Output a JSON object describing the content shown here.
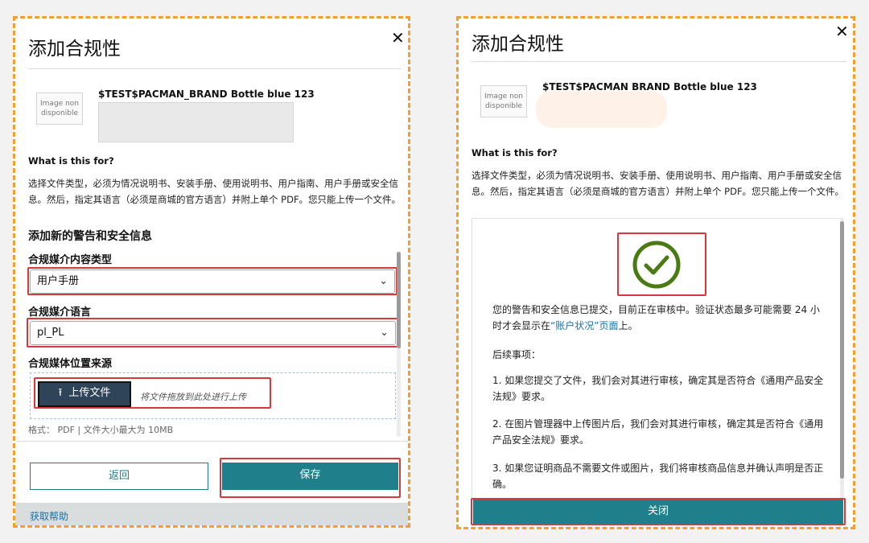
{
  "left": {
    "title": "添加合规性",
    "product_name": "$TEST$PACMAN_BRAND Bottle blue 123",
    "thumb_text": "Image non disponible",
    "what_for": "What is this for?",
    "description": "选择文件类型，必须为情况说明书、安装手册、使用说明书、用户指南、用户手册或安全信息。然后，指定其语言（必须是商城的官方语言）并附上单个 PDF。您只能上传一个文件。",
    "section_title": "添加新的警告和安全信息",
    "content_type_label": "合规媒介内容类型",
    "content_type_value": "用户手册",
    "language_label": "合规媒介语言",
    "language_value": "pl_PL",
    "source_label": "合规媒体位置来源",
    "upload_label": "上传文件",
    "drop_hint": "将文件拖放到此处进行上传",
    "format_info": "格式：  PDF | 文件大小最大为 10MB",
    "back_label": "返回",
    "save_label": "保存",
    "help_label": "获取帮助"
  },
  "right": {
    "title": "添加合规性",
    "product_name": "$TEST$PACMAN  BRAND Bottle blue 123",
    "thumb_text": "Image non disponible",
    "what_for": "What is this for?",
    "description": "选择文件类型，必须为情况说明书、安装手册、使用说明书、用户指南、用户手册或安全信息。然后，指定其语言（必须是商城的官方语言）并附上单个 PDF。您只能上传一个文件。",
    "status_msg_1": "您的警告和安全信息已提交，目前正在审核中。验证状态最多可能需要 24 小时才会显示在",
    "status_link": "“账户状况”页面",
    "status_msg_2": "上。",
    "next_steps": "后续事项：",
    "step_1": "1. 如果您提交了文件，我们会对其进行审核，确定其是否符合《通用产品安全法规》要求。",
    "step_2": "2. 在图片管理器中上传图片后，我们会对其进行审核，确定其是否符合《通用产品安全法规》要求。",
    "step_3": "3. 如果您证明商品不需要文件或图片，我们将审核商品信息并确认声明是否正确。",
    "close_label": "关闭"
  },
  "colors": {
    "accent": "#1f7f8b",
    "highlight": "#d83838",
    "success": "#4a7a12",
    "frame": "#f0a030"
  },
  "icons": {
    "close": "close-icon",
    "chevron": "chevron-down-icon",
    "upload": "upload-icon",
    "success": "check-circle-icon"
  }
}
